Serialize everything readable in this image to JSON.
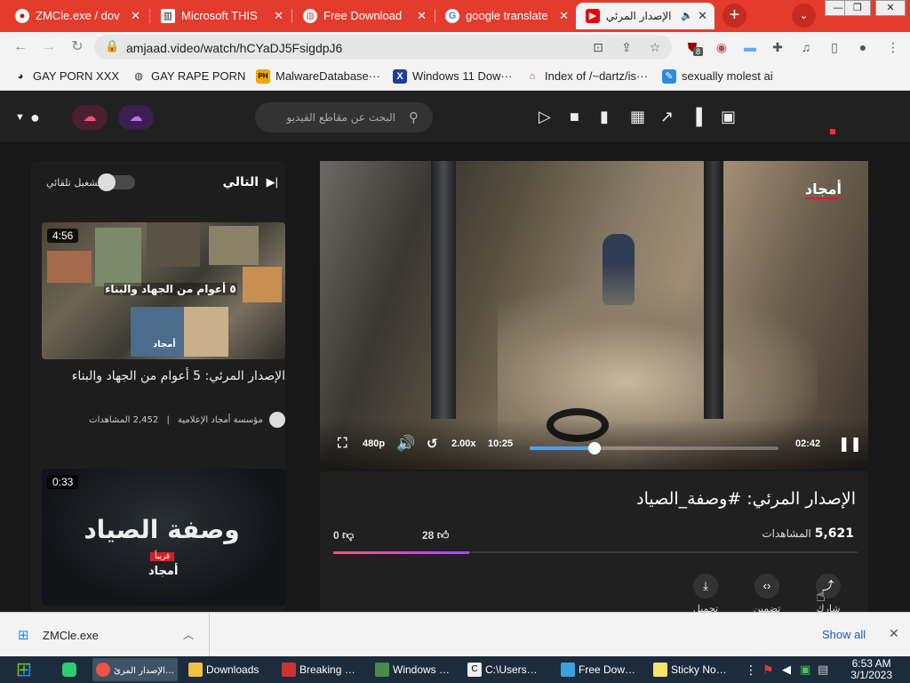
{
  "browser": {
    "tabs": [
      {
        "title": "ZMCle.exe / dov",
        "favicon": "red-circle-icon"
      },
      {
        "title": "Microsoft THIS",
        "favicon": "museum-icon"
      },
      {
        "title": "Free Download",
        "favicon": "globe-icon"
      },
      {
        "title": "google translate",
        "favicon": "google-icon"
      },
      {
        "title": "الإصدار المرئي",
        "favicon": "play-icon",
        "active": true
      }
    ],
    "url": "amjaad.video/watch/hCYaDJ5FsigdpJ6",
    "extension_badge": "8",
    "bookmarks": [
      {
        "label": "GAY PORN XXX"
      },
      {
        "label": "GAY RAPE PORN"
      },
      {
        "label": "MalwareDatabase···",
        "badge": "PH"
      },
      {
        "label": "Windows 11 Dow···",
        "badge": "X"
      },
      {
        "label": "Index of /~dartz/is···"
      },
      {
        "label": "sexually molest ai"
      }
    ]
  },
  "site": {
    "search_placeholder": "البحث عن مقاطع الفيديو",
    "sidebar": {
      "next_label": "التالي",
      "autoplay_label": "تشغيل تلقائي",
      "videos": [
        {
          "duration": "4:56",
          "banner": "٥ أعوام من الجهاد والبناء",
          "logo": "أمجاد",
          "title": "الإصدار المرئي: 5 أعوام من الجهاد والبناء",
          "channel": "مؤسسة أمجاد الإعلامية",
          "views": "2,452 المشاهدات"
        },
        {
          "duration": "0:33",
          "banner": "وصفة الصياد",
          "tag": "قريباً",
          "logo": "أمجاد"
        }
      ]
    },
    "player": {
      "watermark": "أمجاد",
      "quality": "480p",
      "speed": "2.00x",
      "elapsed": "10:25",
      "remaining": "02:42",
      "progress": 0.26
    },
    "video": {
      "title": "الإصدار المرئي: #وصفة_الصياد",
      "views_count": "5,621",
      "views_label": "المشاهدات",
      "likes": "28",
      "dislikes": "0",
      "like_ratio": 0.26,
      "actions": [
        {
          "label": "شارك",
          "icon": "share-icon"
        },
        {
          "label": "تضمين",
          "icon": "embed-icon"
        },
        {
          "label": "تحميل",
          "icon": "download-icon"
        }
      ]
    }
  },
  "downloads": {
    "file": "ZMCle.exe",
    "show_all": "Show all"
  },
  "taskbar": {
    "items": [
      {
        "label": "الإصدار المرئ…",
        "active": true
      },
      {
        "label": "Downloads"
      },
      {
        "label": "Breaking …"
      },
      {
        "label": "Windows …"
      },
      {
        "label": "C:\\Users…"
      },
      {
        "label": "Free Dow…"
      },
      {
        "label": "Sticky No…"
      }
    ],
    "time": "6:53 AM",
    "date": "3/1/2023"
  }
}
